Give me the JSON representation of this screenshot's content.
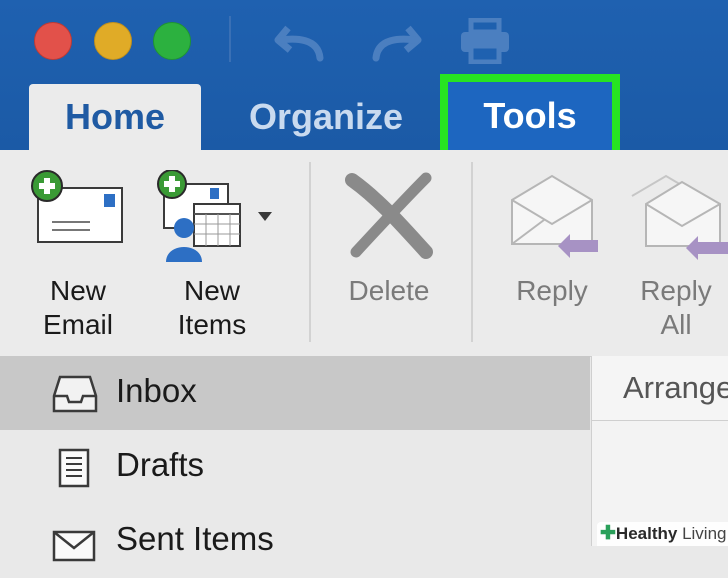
{
  "tabs": {
    "home": "Home",
    "organize": "Organize",
    "tools": "Tools"
  },
  "ribbon": {
    "new_email": [
      "New",
      "Email"
    ],
    "new_items": [
      "New",
      "Items"
    ],
    "delete": "Delete",
    "reply": "Reply",
    "reply_all": [
      "Reply",
      "All"
    ]
  },
  "folders": [
    {
      "label": "Inbox",
      "selected": true
    },
    {
      "label": "Drafts",
      "selected": false
    },
    {
      "label": "Sent Items",
      "selected": false
    }
  ],
  "message_list": {
    "arrange_label": "Arrange By"
  },
  "watermark": {
    "brand": "Healthy",
    "brand_suffix": " Living"
  },
  "colors": {
    "title_blue": "#1f61b0",
    "highlight_green": "#27e422",
    "tab_active_text": "#1f5aa3"
  }
}
